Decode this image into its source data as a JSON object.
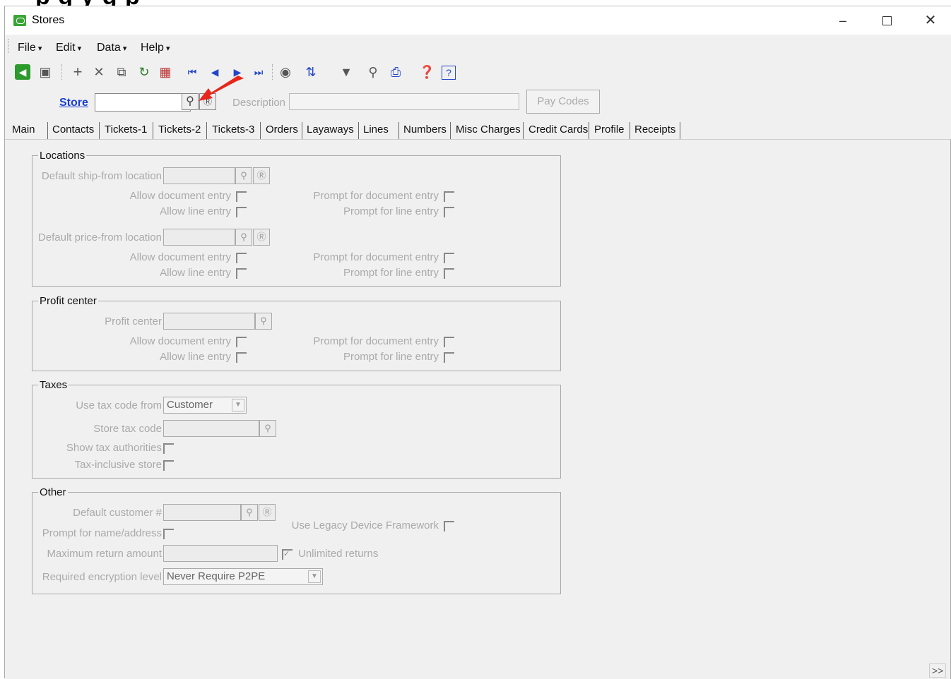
{
  "window": {
    "title": "Stores"
  },
  "menu": [
    {
      "label": "File",
      "accel": "F"
    },
    {
      "label": "Edit",
      "accel": "E"
    },
    {
      "label": "Data",
      "accel": "D"
    },
    {
      "label": "Help",
      "accel": "H"
    }
  ],
  "toolbar_icons": [
    "exit-icon",
    "save-icon",
    "add-icon",
    "delete-icon",
    "copy-icon",
    "refresh-icon",
    "calculator-icon",
    "first-record-icon",
    "previous-record-icon",
    "next-record-icon",
    "last-record-icon",
    "print-icon",
    "sort-icon",
    "filter-icon",
    "find-icon",
    "printer-icon",
    "help-topics-icon",
    "help-icon"
  ],
  "store_bar": {
    "store_label": "Store",
    "store_value": "",
    "description_label": "Description",
    "description_value": "",
    "pay_codes_label": "Pay Codes"
  },
  "tabs": [
    "Main",
    "Contacts",
    "Tickets-1",
    "Tickets-2",
    "Tickets-3",
    "Orders",
    "Layaways",
    "Lines",
    "Numbers",
    "Misc Charges",
    "Credit Cards",
    "Profile",
    "Receipts"
  ],
  "locations": {
    "title": "Locations",
    "ship_from_label": "Default ship-from location",
    "price_from_label": "Default price-from location",
    "allow_document_entry": "Allow document entry",
    "allow_line_entry": "Allow line entry",
    "prompt_document_entry": "Prompt for document entry",
    "prompt_line_entry": "Prompt for line entry"
  },
  "profit_center": {
    "title": "Profit center",
    "label": "Profit center",
    "allow_document_entry": "Allow document entry",
    "allow_line_entry": "Allow line entry",
    "prompt_document_entry": "Prompt for document entry",
    "prompt_line_entry": "Prompt for line entry"
  },
  "taxes": {
    "title": "Taxes",
    "use_tax_code_from_label": "Use tax code from",
    "use_tax_code_from_value": "Customer",
    "store_tax_code_label": "Store tax code",
    "show_tax_authorities_label": "Show tax authorities",
    "tax_inclusive_store_label": "Tax-inclusive store"
  },
  "other": {
    "title": "Other",
    "default_customer_label": "Default customer #",
    "prompt_name_address_label": "Prompt for name/address",
    "max_return_amount_label": "Maximum return amount",
    "unlimited_returns_label": "Unlimited returns",
    "unlimited_returns_checked": true,
    "encryption_level_label": "Required encryption level",
    "encryption_level_value": "Never Require P2PE",
    "legacy_device_label": "Use Legacy Device Framework"
  },
  "more_button_label": ">>"
}
